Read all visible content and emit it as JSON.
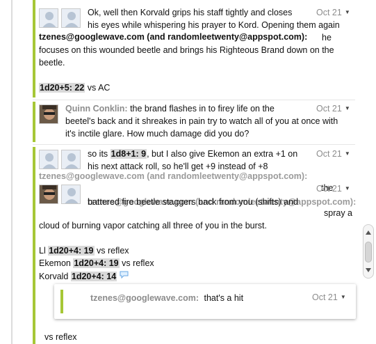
{
  "colors": {
    "thread_green": "#a6c736",
    "meta_gray": "#8c8c8c",
    "roll_bg": "#d9d9d9"
  },
  "blip1": {
    "date": "Oct 21",
    "line1": "Ok, well then Korvald grips his staff tightly and closes",
    "line2": "his eyes while whispering his prayer to Kord.  Opening them again",
    "authors": "tzenes@googlewave.com (and randomleetwenty@appspot.com):",
    "line3_tail": "he",
    "line4": "focuses on this wounded beetle and brings his Righteous Brand down on the",
    "line5": "beetle.",
    "roll": "1d20+5: 22",
    "roll_tail": "vs AC"
  },
  "blip2": {
    "author": "Quinn Conklin:",
    "date": "Oct 21",
    "line1": "the brand flashes in to firey life on the",
    "line2": "beetel's back and it shreakes in pain try to watch all of you at once with",
    "line3": "it's inctile glare. How much damage did you do?"
  },
  "blip3": {
    "date": "Oct 21",
    "pre": "so its",
    "roll": "1d8+1: 9",
    "post": ", but I also give Ekemon an extra +1 on",
    "line2": "his next attack roll, so he'll get +9 instead of +8"
  },
  "blip4": {
    "overlay_authors_1": "tzenes@googlewave.com (and randomleetwenty@appspot.com):",
    "overlay_authors_2": "tzenes@googlewave.com (and randomleetwenty@appspot.com):",
    "date": "Oct 21",
    "line1_tail": "the",
    "line1": "battered fire beetle staggers back from you (shifts) and",
    "line2_tail": "spray a",
    "line3": "cloud of burning vapor catching all three of you in the burst.",
    "rolls": [
      {
        "name": "Ll",
        "roll": "1d20+4: 19",
        "tail": "vs reflex"
      },
      {
        "name": "Ekemon",
        "roll": "1d20+4: 19",
        "tail": "vs reflex"
      },
      {
        "name": "Korvald",
        "roll": "1d20+4: 14",
        "tail": ""
      }
    ]
  },
  "reply": {
    "author": "tzenes@googlewave.com:",
    "text": "that's a hit",
    "date": "Oct 21"
  },
  "footer_text": "vs reflex"
}
